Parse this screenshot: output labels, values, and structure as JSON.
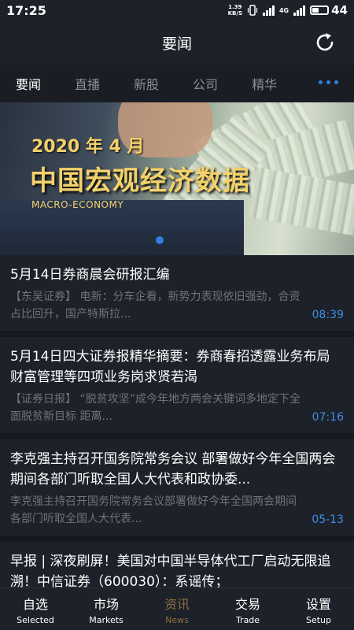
{
  "status_bar": {
    "time": "17:25",
    "net_speed_value": "1.39",
    "net_speed_unit": "KB/S",
    "signal_label": "4G",
    "battery_percent": "44",
    "battery_level": 0.44
  },
  "header": {
    "title": "要闻",
    "refresh_icon": "refresh-icon"
  },
  "tabs": [
    {
      "label": "要闻",
      "active": true
    },
    {
      "label": "直播",
      "active": false
    },
    {
      "label": "新股",
      "active": false
    },
    {
      "label": "公司",
      "active": false
    },
    {
      "label": "精华",
      "active": false
    }
  ],
  "banner": {
    "year_month": "2020 年 4 月",
    "title": "中国宏观经济数据",
    "subtitle": "MACRO-ECONOMY",
    "pages": 1,
    "current_page": 1
  },
  "news": [
    {
      "headline": "5月14日券商晨会研报汇编",
      "summary": "【东吴证券】 电新：分车企看，新势力表现依旧强劲，合资占比回升，国产特斯拉...",
      "time": "08:39"
    },
    {
      "headline": "5月14日四大证券报精华摘要：券商春招透露业务布局 财富管理等四项业务岗求贤若渴",
      "summary": "【证券日报】 “脱贫攻坚”成今年地方两会关键词多地定下全面脱贫新目标 距离...",
      "time": "07:16"
    },
    {
      "headline": "李克强主持召开国务院常务会议 部署做好今年全国两会期间各部门听取全国人大代表和政协委...",
      "summary": "李克强主持召开国务院常务会议部署做好今年全国两会期间各部门听取全国人大代表...",
      "time": "05-13"
    },
    {
      "headline": "早报 | 深夜刷屏！美国对中国半导体代工厂启动无限追溯！中信证券（600030）：系谣传；",
      "summary": "",
      "time": ""
    }
  ],
  "bottom_nav": [
    {
      "cn": "自选",
      "en": "Selected",
      "active": false
    },
    {
      "cn": "市场",
      "en": "Markets",
      "active": false
    },
    {
      "cn": "资讯",
      "en": "News",
      "active": true
    },
    {
      "cn": "交易",
      "en": "Trade",
      "active": false
    },
    {
      "cn": "设置",
      "en": "Setup",
      "active": false
    }
  ],
  "colors": {
    "accent_blue": "#2f7fe0",
    "time_blue": "#3f8ee8",
    "nav_active": "#8a6d3f",
    "banner_gold": "#f3d16b"
  }
}
